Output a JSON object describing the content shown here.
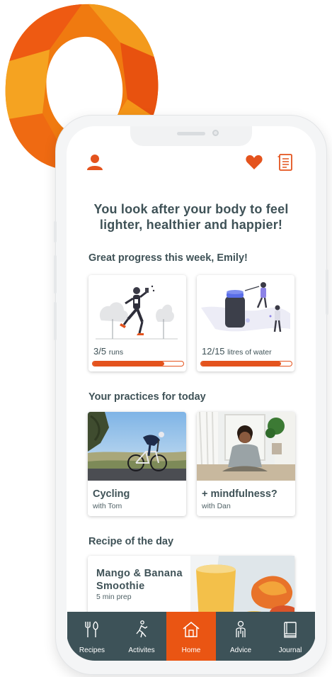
{
  "colors": {
    "accent": "#ea5513",
    "nav_bg": "#3d5258",
    "text": "#3f5257"
  },
  "header": {
    "left_icon": "user-icon",
    "right_icons": [
      "heart-icon",
      "document-list-icon"
    ]
  },
  "headline": {
    "line1": "You look after your body to feel",
    "line2": "lighter, healthier and happier!"
  },
  "progress": {
    "title": "Great progress this week, Emily!",
    "cards": [
      {
        "count": "3/5",
        "unit": "runs",
        "fraction": 0.6
      },
      {
        "count": "12/15",
        "unit": "litres of water",
        "fraction": 0.8
      }
    ]
  },
  "practices": {
    "title": "Your practices for today",
    "items": [
      {
        "name": "Cycling",
        "with": "with Tom"
      },
      {
        "name": "+ mindfulness?",
        "with": "with Dan"
      }
    ]
  },
  "recipe": {
    "title": "Recipe of the day",
    "name": "Mango & Banana Smoothie",
    "prep": "5 min prep"
  },
  "nav": {
    "active": "Home",
    "items": [
      {
        "label": "Recipes",
        "icon": "cutlery-icon"
      },
      {
        "label": "Activites",
        "icon": "running-icon"
      },
      {
        "label": "Home",
        "icon": "home-icon"
      },
      {
        "label": "Advice",
        "icon": "advisor-icon"
      },
      {
        "label": "Journal",
        "icon": "journal-icon"
      }
    ]
  }
}
